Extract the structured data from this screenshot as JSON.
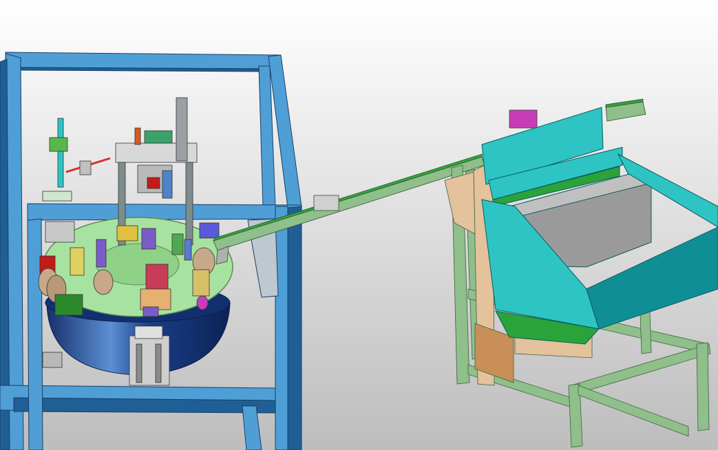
{
  "viewport": {
    "background_top": "#ffffff",
    "background_bottom": "#bdbdbd"
  },
  "colors": {
    "frame_blue": "#4f9fd6",
    "frame_blue_dark": "#1f5f95",
    "turntable_green": "#a8e2a0",
    "turntable_base": "#1b3f8a",
    "bin_cyan": "#2ec4c4",
    "bin_cyan_dark": "#0f8f95",
    "aluminum_green": "#8fbf8a",
    "conveyor_green": "#2fa83a",
    "panel_tan": "#e3c29c",
    "panel_grey": "#9a9a9a",
    "motor_red": "#c41a1a",
    "part_magenta": "#c83cb8",
    "part_purple": "#7a5cc8"
  },
  "parts": [
    "blue-steel-frame",
    "rotary-indexing-table",
    "assembly-stations",
    "linear-conveyor",
    "vibratory-hopper-bin",
    "aluminum-profile-stand"
  ]
}
